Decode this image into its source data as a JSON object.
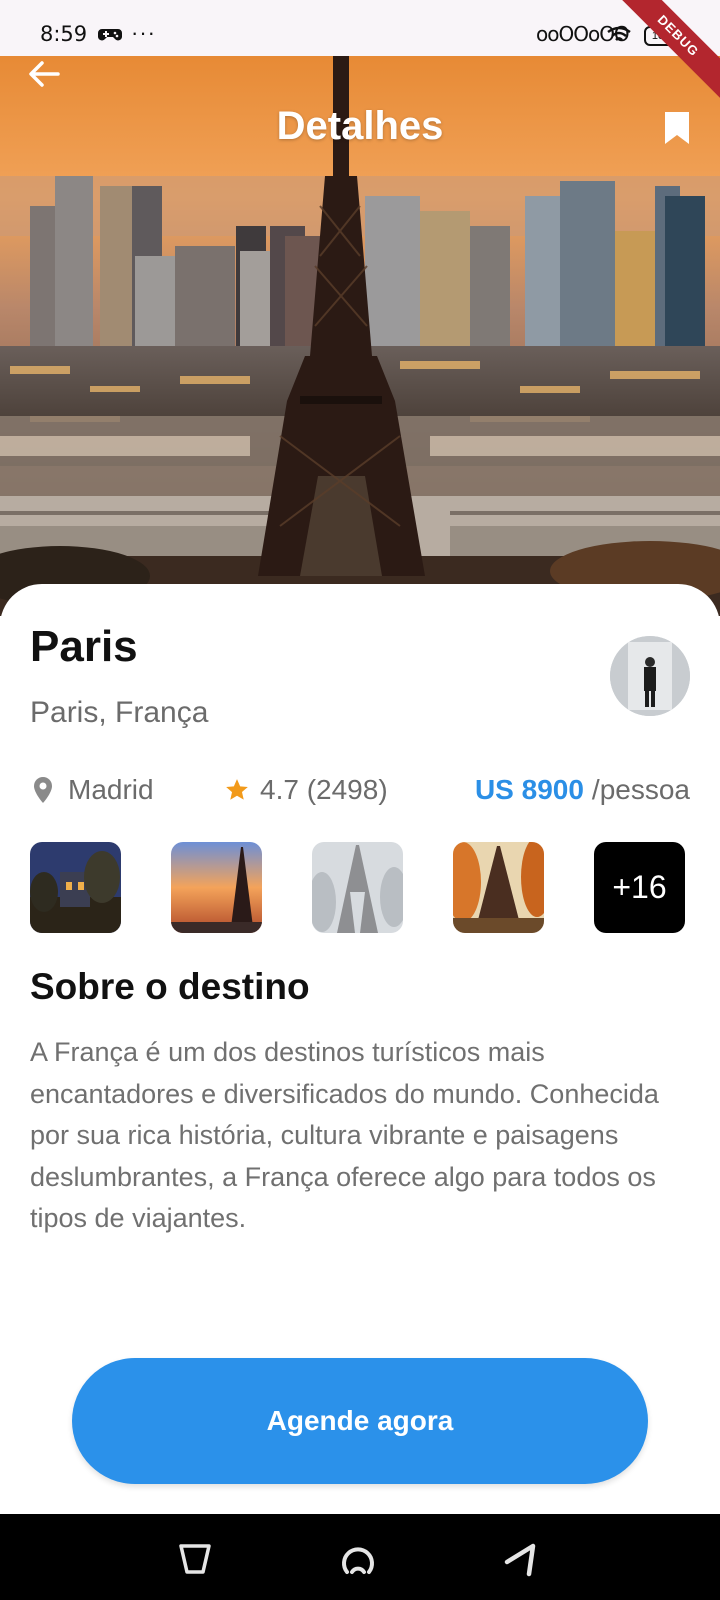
{
  "status_bar": {
    "time": "8:59",
    "more_dots": "···",
    "signal": "ooOOoOO",
    "battery": "100",
    "debug_label": "DEBUG"
  },
  "header": {
    "title": "Detalhes",
    "back_icon": "arrow-left-icon",
    "bookmark_icon": "bookmark-icon"
  },
  "destination": {
    "name": "Paris",
    "location": "Paris, França",
    "origin": "Madrid",
    "rating": "4.7 (2498)",
    "price": "US 8900",
    "price_unit": "/pessoa",
    "more_photos": "+16"
  },
  "about": {
    "title": "Sobre o destino",
    "text": "A França é um dos destinos turísticos mais encantadores e diversificados do mundo. Conhecida por sua rica história, cultura vibrante e paisagens deslumbrantes, a França oferece algo para todos os tipos de viajantes."
  },
  "cta": {
    "label": "Agende agora"
  },
  "colors": {
    "accent": "#2b91ea",
    "price": "#2b8fe6",
    "star": "#f29a1a",
    "text_secondary": "#6b6b6b"
  },
  "nav_bar": {
    "icons": [
      "back-nav-icon",
      "home-nav-icon",
      "recents-nav-icon"
    ]
  }
}
